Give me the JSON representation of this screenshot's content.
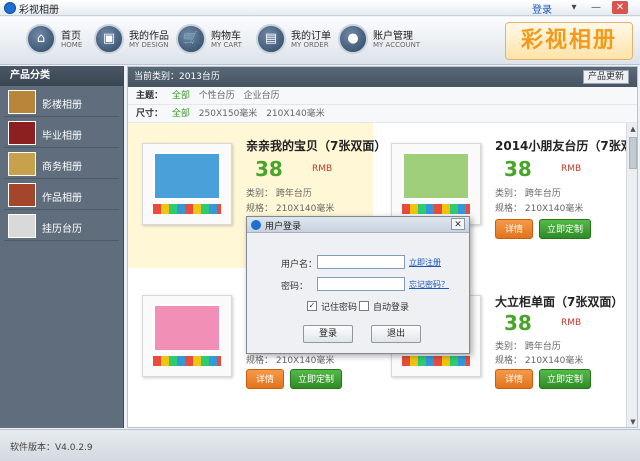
{
  "window": {
    "title": "彩视相册",
    "login_link": "登录",
    "menu_glyph": "▾",
    "minimize_glyph": "—",
    "close_glyph": "✕"
  },
  "nav": [
    {
      "label": "首页",
      "sub": "HOME",
      "icon": "home-icon",
      "glyph": "⌂"
    },
    {
      "label": "我的作品",
      "sub": "MY DESIGN",
      "icon": "design-icon",
      "glyph": "▣"
    },
    {
      "label": "购物车",
      "sub": "MY CART",
      "icon": "cart-icon",
      "glyph": "🛒"
    },
    {
      "label": "我的订单",
      "sub": "MY ORDER",
      "icon": "order-icon",
      "glyph": "▤"
    },
    {
      "label": "账户管理",
      "sub": "MY ACCOUNT",
      "icon": "account-icon",
      "glyph": "●"
    }
  ],
  "brand": "彩视相册",
  "sidebar": {
    "heading": "产品分类",
    "items": [
      {
        "label": "影楼相册",
        "color": "#b8863b"
      },
      {
        "label": "毕业相册",
        "color": "#8c1f1f"
      },
      {
        "label": "商务相册",
        "color": "#c8a24a"
      },
      {
        "label": "作品相册",
        "color": "#a4462a"
      },
      {
        "label": "挂历台历",
        "color": "#d9d9d9"
      }
    ]
  },
  "content": {
    "crumb": "当前类别：2013台历",
    "update_button": "产品更新",
    "filter_theme": {
      "key": "主题：",
      "active": "全部",
      "options": [
        "个性台历",
        "企业台历"
      ]
    },
    "filter_size": {
      "key": "尺寸：",
      "active": "全部",
      "options": [
        "250X150毫米",
        "210X140毫米"
      ]
    }
  },
  "products": [
    {
      "name": "亲亲我的宝贝（7张双面）",
      "price": "38",
      "unit": "RMB",
      "category": "类别：   跨年台历",
      "spec": "规格：   210X140毫米",
      "pic_color": "#4aa0d8",
      "highlight": true
    },
    {
      "name": "2014小朋友台历（7张双",
      "price": "38",
      "unit": "RMB",
      "category": "类别：   跨年台历",
      "spec": "规格：   210X140毫米",
      "pic_color": "#9fcf7a",
      "highlight": false
    },
    {
      "name": "",
      "price": "",
      "unit": "",
      "category": "",
      "spec": "规格：   210X140毫米",
      "pic_color": "#f28fb7",
      "highlight": false
    },
    {
      "name": "大立柜单面（7张双面）",
      "price": "38",
      "unit": "RMB",
      "category": "类别：   跨年台历",
      "spec": "规格：   210X140毫米",
      "pic_color": "#d8b79a",
      "highlight": false
    }
  ],
  "buttons": {
    "detail": "详情",
    "custom": "立即定制"
  },
  "status": {
    "version": "软件版本：V4.0.2.9"
  },
  "dialog": {
    "title": "用户登录",
    "close_glyph": "✕",
    "username_label": "用户名：",
    "username_value": "",
    "register_link": "立即注册",
    "password_label": "密码：",
    "password_value": "",
    "forgot_link": "忘记密码？",
    "remember_label": "记住密码",
    "remember_checked": "✓",
    "autologin_label": "自动登录",
    "login_button": "登录",
    "exit_button": "退出"
  },
  "scrollbar": {
    "up_glyph": "▲",
    "down_glyph": "▼"
  }
}
